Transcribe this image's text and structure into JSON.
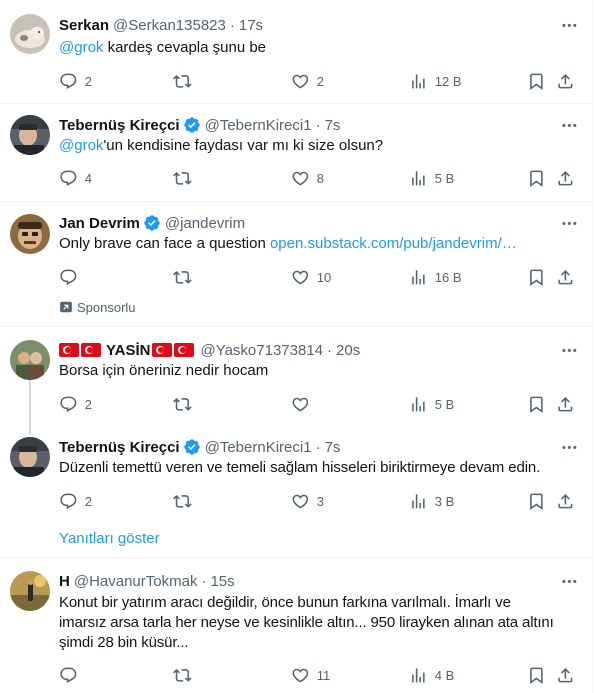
{
  "tweets": [
    {
      "name": "Serkan",
      "handle": "@Serkan135823",
      "time": "17s",
      "text_mention": "@grok",
      "text_rest": " kardeş cevapla şunu be",
      "replies": "2",
      "retweets": "",
      "likes": "2",
      "views": "12 B"
    },
    {
      "name": "Tebernüş Kireçci",
      "handle": "@TebernKireci1",
      "time": "7s",
      "text_mention": "@grok",
      "text_rest": "'un kendisine faydası var mı ki size olsun?",
      "replies": "4",
      "retweets": "",
      "likes": "8",
      "views": "5 B"
    },
    {
      "name": "Jan Devrim",
      "handle": "@jandevrim",
      "text_plain": "Only brave can face a question ",
      "text_link": "open.substack.com/pub/jandevrim/…",
      "replies": "",
      "retweets": "",
      "likes": "10",
      "views": "16 B",
      "sponsored_label": "Sponsorlu"
    },
    {
      "name": "YASİN",
      "handle": "@Yasko71373814",
      "time": "20s",
      "text": "Borsa için öneriniz nedir hocam",
      "replies": "2",
      "retweets": "",
      "likes": "",
      "views": "5 B"
    },
    {
      "name": "Tebernüş Kireçci",
      "handle": "@TebernKireci1",
      "time": "7s",
      "text": "Düzenli temettü veren ve temeli sağlam hisseleri biriktirmeye devam edin.",
      "replies": "2",
      "retweets": "",
      "likes": "3",
      "views": "3 B"
    },
    {
      "name": "H",
      "handle": "@HavanurTokmak",
      "time": "15s",
      "text_lines": [
        "Konut bir yatırım aracı değildir, önce bunun farkına varılmalı. İmarlı ve",
        "imarsız arsa tarla her neyse ve kesinlikle altın... 950 lirayken alınan ata altını",
        "şimdi 28 bin küsür..."
      ],
      "replies": "",
      "retweets": "",
      "likes": "11",
      "views": "4 B"
    }
  ],
  "show_replies_label": "Yanıtları göster",
  "colors": {
    "accent": "#1d9bf0",
    "muted": "#536471",
    "text": "#0f1419",
    "border": "#eff3f4"
  }
}
